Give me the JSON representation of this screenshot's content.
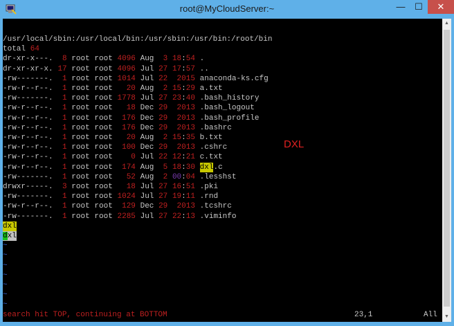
{
  "window": {
    "title": "root@MyCloudServer:~",
    "controls": {
      "minimize": "—",
      "maximize": "☐",
      "close": "✕"
    }
  },
  "terminal": {
    "path_line": "/usr/local/sbin:/usr/local/bin:/usr/sbin:/usr/bin:/root/bin",
    "total_label": "total",
    "total_value": "64",
    "entries": [
      {
        "perm": "dr-xr-x---.",
        "links": "8",
        "owner": "root",
        "group": "root",
        "size": "4096",
        "month": "Aug",
        "day": "3",
        "time": "18:54",
        "name": "."
      },
      {
        "perm": "dr-xr-xr-x.",
        "links": "17",
        "owner": "root",
        "group": "root",
        "size": "4096",
        "month": "Jul",
        "day": "27",
        "time": "17:57",
        "name": ".."
      },
      {
        "perm": "-rw-------.",
        "links": "1",
        "owner": "root",
        "group": "root",
        "size": "1014",
        "month": "Jul",
        "day": "22",
        "time": "2015",
        "name": "anaconda-ks.cfg"
      },
      {
        "perm": "-rw-r--r--.",
        "links": "1",
        "owner": "root",
        "group": "root",
        "size": "20",
        "month": "Aug",
        "day": "2",
        "time": "15:29",
        "name": "a.txt"
      },
      {
        "perm": "-rw-------.",
        "links": "1",
        "owner": "root",
        "group": "root",
        "size": "1778",
        "month": "Jul",
        "day": "27",
        "time": "23:40",
        "name": ".bash_history"
      },
      {
        "perm": "-rw-r--r--.",
        "links": "1",
        "owner": "root",
        "group": "root",
        "size": "18",
        "month": "Dec",
        "day": "29",
        "time": "2013",
        "name": ".bash_logout"
      },
      {
        "perm": "-rw-r--r--.",
        "links": "1",
        "owner": "root",
        "group": "root",
        "size": "176",
        "month": "Dec",
        "day": "29",
        "time": "2013",
        "name": ".bash_profile"
      },
      {
        "perm": "-rw-r--r--.",
        "links": "1",
        "owner": "root",
        "group": "root",
        "size": "176",
        "month": "Dec",
        "day": "29",
        "time": "2013",
        "name": ".bashrc"
      },
      {
        "perm": "-rw-r--r--.",
        "links": "1",
        "owner": "root",
        "group": "root",
        "size": "20",
        "month": "Aug",
        "day": "2",
        "time": "15:35",
        "name": "b.txt"
      },
      {
        "perm": "-rw-r--r--.",
        "links": "1",
        "owner": "root",
        "group": "root",
        "size": "100",
        "month": "Dec",
        "day": "29",
        "time": "2013",
        "name": ".cshrc"
      },
      {
        "perm": "-rw-r--r--.",
        "links": "1",
        "owner": "root",
        "group": "root",
        "size": "0",
        "month": "Jul",
        "day": "22",
        "time": "12:21",
        "name": "c.txt"
      },
      {
        "perm": "-rw-r--r--.",
        "links": "1",
        "owner": "root",
        "group": "root",
        "size": "174",
        "month": "Aug",
        "day": "5",
        "time": "18:30",
        "name": "dxl.c"
      },
      {
        "perm": "-rw-------.",
        "links": "1",
        "owner": "root",
        "group": "root",
        "size": "52",
        "month": "Aug",
        "day": "2",
        "time": "00:04",
        "name": ".lesshst"
      },
      {
        "perm": "drwxr-----.",
        "links": "3",
        "owner": "root",
        "group": "root",
        "size": "18",
        "month": "Jul",
        "day": "27",
        "time": "16:51",
        "name": ".pki"
      },
      {
        "perm": "-rw-------.",
        "links": "1",
        "owner": "root",
        "group": "root",
        "size": "1024",
        "month": "Jul",
        "day": "27",
        "time": "19:11",
        "name": ".rnd"
      },
      {
        "perm": "-rw-r--r--.",
        "links": "1",
        "owner": "root",
        "group": "root",
        "size": "129",
        "month": "Dec",
        "day": "29",
        "time": "2013",
        "name": ".tcshrc"
      },
      {
        "perm": "-rw-------.",
        "links": "1",
        "owner": "root",
        "group": "root",
        "size": "2285",
        "month": "Jul",
        "day": "27",
        "time": "22:13",
        "name": ".viminfo"
      }
    ],
    "search_lines": [
      "dxl",
      "dxl"
    ],
    "tilde": "~",
    "tilde_count": 7,
    "status_message": "search hit TOP, continuing at BOTTOM",
    "cursor_pos": "23,1",
    "scroll_pos": "All"
  },
  "annotation": {
    "text": "DXL",
    "color": "#e02020"
  },
  "colors": {
    "accent_red": "#c02020",
    "highlight_yellow": "#c8c800",
    "highlight_green": "#18c018",
    "tilde_blue": "#2f5fd0"
  },
  "icons": {
    "app": "putty-terminal-icon",
    "scroll_up": "scroll-up-arrow-icon",
    "scroll_down": "scroll-down-arrow-icon"
  }
}
